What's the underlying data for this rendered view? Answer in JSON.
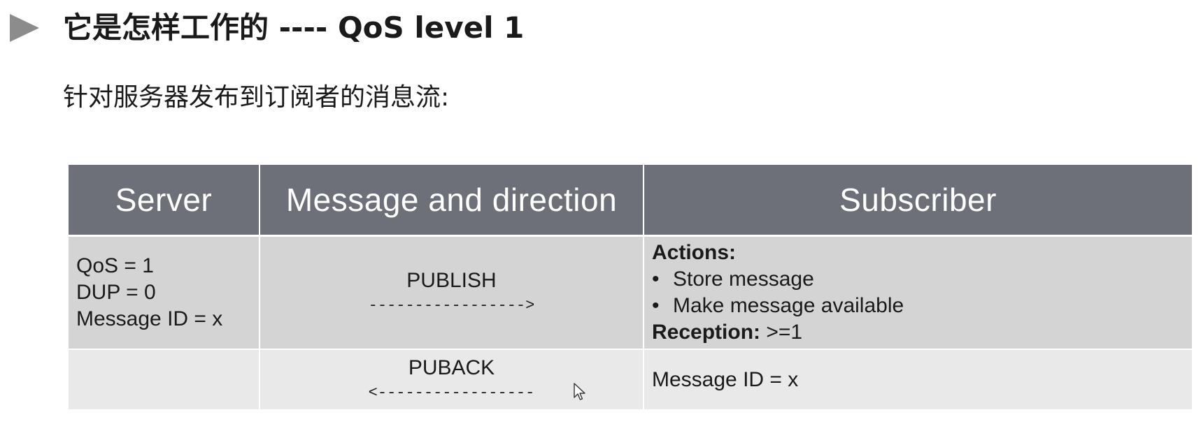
{
  "slide": {
    "title": "它是怎样工作的 ---- QoS level 1",
    "subtitle": "针对服务器发布到订阅者的消息流:"
  },
  "table": {
    "headers": {
      "server": "Server",
      "message": "Message and direction",
      "subscriber": "Subscriber"
    },
    "publish_row": {
      "server_lines": [
        "QoS = 1",
        "DUP = 0",
        "Message ID = x"
      ],
      "message_name": "PUBLISH",
      "arrow": "----------------->",
      "actions_title": "Actions:",
      "actions": [
        "Store message",
        "Make message available"
      ],
      "reception_label": "Reception:",
      "reception_value": " >=1"
    },
    "puback_row": {
      "server_text": "",
      "message_name": "PUBACK",
      "arrow": "<-----------------",
      "subscriber_text": "Message ID = x"
    }
  },
  "icons": {
    "bullet": "play-triangle-icon",
    "cursor": "mouse-pointer-icon"
  },
  "colors": {
    "header_bg": "#6e7079",
    "row1_bg": "#d4d4d4",
    "row2_bg": "#e9e9e9",
    "bullet": "#8c8c8c"
  }
}
